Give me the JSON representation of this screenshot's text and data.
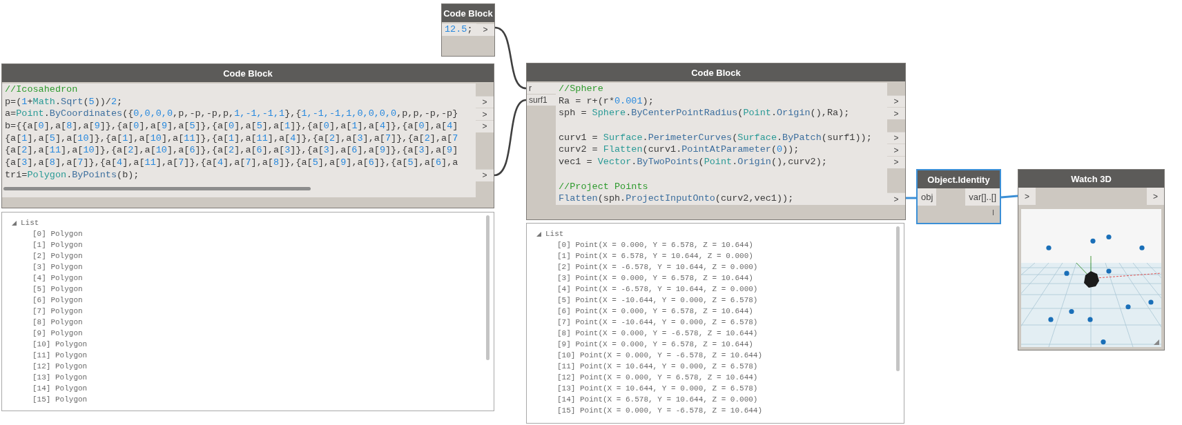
{
  "nodes": [
    {
      "kind": "code",
      "title": "Code Block",
      "selected": false,
      "lines": [
        {
          "kind": "code",
          "segs": [
            {
              "t": "12.5",
              "kind": "number"
            },
            {
              "t": ";"
            }
          ],
          "port": ">"
        }
      ]
    },
    {
      "kind": "code",
      "title": "Code Block",
      "selected": false,
      "lines": [
        {
          "kind": "code",
          "segs": [
            {
              "t": "//Icosahedron",
              "kind": "comment"
            }
          ]
        },
        {
          "kind": "code",
          "segs": [
            {
              "t": "p=("
            },
            {
              "t": "1",
              "kind": "number"
            },
            {
              "t": "+"
            },
            {
              "t": "Math",
              "kind": "type"
            },
            {
              "t": "."
            },
            {
              "t": "Sqrt",
              "kind": "method"
            },
            {
              "t": "("
            },
            {
              "t": "5",
              "kind": "number"
            },
            {
              "t": "))/"
            },
            {
              "t": "2",
              "kind": "number"
            },
            {
              "t": ";"
            }
          ],
          "port": ">"
        },
        {
          "kind": "code",
          "segs": [
            {
              "t": "a="
            },
            {
              "t": "Point",
              "kind": "type"
            },
            {
              "t": "."
            },
            {
              "t": "ByCoordinates",
              "kind": "method"
            },
            {
              "t": "({"
            },
            {
              "t": "0,0,0,0",
              "kind": "number"
            },
            {
              "t": ",p,-p,-p,p,"
            },
            {
              "t": "1,-1,-1,1",
              "kind": "number"
            },
            {
              "t": "},{"
            },
            {
              "t": "1,-1,-1,1,0,0,0,0",
              "kind": "number"
            },
            {
              "t": ",p,p,-p,-p}"
            }
          ],
          "port": ">"
        },
        {
          "kind": "code",
          "segs": [
            {
              "t": "b={{a["
            },
            {
              "t": "0",
              "kind": "number"
            },
            {
              "t": "],a["
            },
            {
              "t": "8",
              "kind": "number"
            },
            {
              "t": "],a["
            },
            {
              "t": "9",
              "kind": "number"
            },
            {
              "t": "]},{a["
            },
            {
              "t": "0",
              "kind": "number"
            },
            {
              "t": "],a["
            },
            {
              "t": "9",
              "kind": "number"
            },
            {
              "t": "],a["
            },
            {
              "t": "5",
              "kind": "number"
            },
            {
              "t": "]},{a["
            },
            {
              "t": "0",
              "kind": "number"
            },
            {
              "t": "],a["
            },
            {
              "t": "5",
              "kind": "number"
            },
            {
              "t": "],a["
            },
            {
              "t": "1",
              "kind": "number"
            },
            {
              "t": "]},{a["
            },
            {
              "t": "0",
              "kind": "number"
            },
            {
              "t": "],a["
            },
            {
              "t": "1",
              "kind": "number"
            },
            {
              "t": "],a["
            },
            {
              "t": "4",
              "kind": "number"
            },
            {
              "t": "]},{a["
            },
            {
              "t": "0",
              "kind": "number"
            },
            {
              "t": "],a["
            },
            {
              "t": "4",
              "kind": "number"
            },
            {
              "t": "]"
            }
          ],
          "port": ">"
        },
        {
          "kind": "code",
          "segs": [
            {
              "t": "{a["
            },
            {
              "t": "1",
              "kind": "number"
            },
            {
              "t": "],a["
            },
            {
              "t": "5",
              "kind": "number"
            },
            {
              "t": "],a["
            },
            {
              "t": "10",
              "kind": "number"
            },
            {
              "t": "]},{a["
            },
            {
              "t": "1",
              "kind": "number"
            },
            {
              "t": "],a["
            },
            {
              "t": "10",
              "kind": "number"
            },
            {
              "t": "],a["
            },
            {
              "t": "11",
              "kind": "number"
            },
            {
              "t": "]},{a["
            },
            {
              "t": "1",
              "kind": "number"
            },
            {
              "t": "],a["
            },
            {
              "t": "11",
              "kind": "number"
            },
            {
              "t": "],a["
            },
            {
              "t": "4",
              "kind": "number"
            },
            {
              "t": "]},{a["
            },
            {
              "t": "2",
              "kind": "number"
            },
            {
              "t": "],a["
            },
            {
              "t": "3",
              "kind": "number"
            },
            {
              "t": "],a["
            },
            {
              "t": "7",
              "kind": "number"
            },
            {
              "t": "]},{a["
            },
            {
              "t": "2",
              "kind": "number"
            },
            {
              "t": "],a["
            },
            {
              "t": "7",
              "kind": "number"
            }
          ]
        },
        {
          "kind": "code",
          "segs": [
            {
              "t": "{a["
            },
            {
              "t": "2",
              "kind": "number"
            },
            {
              "t": "],a["
            },
            {
              "t": "11",
              "kind": "number"
            },
            {
              "t": "],a["
            },
            {
              "t": "10",
              "kind": "number"
            },
            {
              "t": "]},{a["
            },
            {
              "t": "2",
              "kind": "number"
            },
            {
              "t": "],a["
            },
            {
              "t": "10",
              "kind": "number"
            },
            {
              "t": "],a["
            },
            {
              "t": "6",
              "kind": "number"
            },
            {
              "t": "]},{a["
            },
            {
              "t": "2",
              "kind": "number"
            },
            {
              "t": "],a["
            },
            {
              "t": "6",
              "kind": "number"
            },
            {
              "t": "],a["
            },
            {
              "t": "3",
              "kind": "number"
            },
            {
              "t": "]},{a["
            },
            {
              "t": "3",
              "kind": "number"
            },
            {
              "t": "],a["
            },
            {
              "t": "6",
              "kind": "number"
            },
            {
              "t": "],a["
            },
            {
              "t": "9",
              "kind": "number"
            },
            {
              "t": "]},{a["
            },
            {
              "t": "3",
              "kind": "number"
            },
            {
              "t": "],a["
            },
            {
              "t": "9",
              "kind": "number"
            },
            {
              "t": "]"
            }
          ]
        },
        {
          "kind": "code",
          "segs": [
            {
              "t": "{a["
            },
            {
              "t": "3",
              "kind": "number"
            },
            {
              "t": "],a["
            },
            {
              "t": "8",
              "kind": "number"
            },
            {
              "t": "],a["
            },
            {
              "t": "7",
              "kind": "number"
            },
            {
              "t": "]},{a["
            },
            {
              "t": "4",
              "kind": "number"
            },
            {
              "t": "],a["
            },
            {
              "t": "11",
              "kind": "number"
            },
            {
              "t": "],a["
            },
            {
              "t": "7",
              "kind": "number"
            },
            {
              "t": "]},{a["
            },
            {
              "t": "4",
              "kind": "number"
            },
            {
              "t": "],a["
            },
            {
              "t": "7",
              "kind": "number"
            },
            {
              "t": "],a["
            },
            {
              "t": "8",
              "kind": "number"
            },
            {
              "t": "]},{a["
            },
            {
              "t": "5",
              "kind": "number"
            },
            {
              "t": "],a["
            },
            {
              "t": "9",
              "kind": "number"
            },
            {
              "t": "],a["
            },
            {
              "t": "6",
              "kind": "number"
            },
            {
              "t": "]},{a["
            },
            {
              "t": "5",
              "kind": "number"
            },
            {
              "t": "],a["
            },
            {
              "t": "6",
              "kind": "number"
            },
            {
              "t": "],a"
            }
          ]
        },
        {
          "kind": "code",
          "segs": [
            {
              "t": "tri="
            },
            {
              "t": "Polygon",
              "kind": "type"
            },
            {
              "t": "."
            },
            {
              "t": "ByPoints",
              "kind": "method"
            },
            {
              "t": "(b);"
            }
          ],
          "port": ">"
        }
      ],
      "preview": {
        "root": "List",
        "expanded": true,
        "items": [
          "[0] Polygon",
          "[1] Polygon",
          "[2] Polygon",
          "[3] Polygon",
          "[4] Polygon",
          "[5] Polygon",
          "[6] Polygon",
          "[7] Polygon",
          "[8] Polygon",
          "[9] Polygon",
          "[10] Polygon",
          "[11] Polygon",
          "[12] Polygon",
          "[13] Polygon",
          "[14] Polygon",
          "[15] Polygon"
        ]
      }
    },
    {
      "kind": "code",
      "title": "Code Block",
      "selected": false,
      "inputs": [
        "r",
        "surf1"
      ],
      "lines": [
        {
          "kind": "code",
          "segs": [
            {
              "t": "//Sphere",
              "kind": "comment"
            }
          ]
        },
        {
          "kind": "code",
          "segs": [
            {
              "t": "Ra = r+(r*"
            },
            {
              "t": "0.001",
              "kind": "number"
            },
            {
              "t": ");"
            }
          ],
          "port": ">"
        },
        {
          "kind": "code",
          "segs": [
            {
              "t": "sph = "
            },
            {
              "t": "Sphere",
              "kind": "type"
            },
            {
              "t": "."
            },
            {
              "t": "ByCenterPointRadius",
              "kind": "method"
            },
            {
              "t": "("
            },
            {
              "t": "Point",
              "kind": "type"
            },
            {
              "t": "."
            },
            {
              "t": "Origin",
              "kind": "method"
            },
            {
              "t": "(),Ra);"
            }
          ],
          "port": ">"
        },
        {
          "kind": "blank"
        },
        {
          "kind": "code",
          "segs": [
            {
              "t": "curv1 = "
            },
            {
              "t": "Surface",
              "kind": "type"
            },
            {
              "t": "."
            },
            {
              "t": "PerimeterCurves",
              "kind": "method"
            },
            {
              "t": "("
            },
            {
              "t": "Surface",
              "kind": "type"
            },
            {
              "t": "."
            },
            {
              "t": "ByPatch",
              "kind": "method"
            },
            {
              "t": "(surf1));"
            }
          ],
          "port": ">"
        },
        {
          "kind": "code",
          "segs": [
            {
              "t": "curv2 = "
            },
            {
              "t": "Flatten",
              "kind": "type"
            },
            {
              "t": "(curv1."
            },
            {
              "t": "PointAtParameter",
              "kind": "method"
            },
            {
              "t": "("
            },
            {
              "t": "0",
              "kind": "number"
            },
            {
              "t": "));"
            }
          ],
          "port": ">"
        },
        {
          "kind": "code",
          "segs": [
            {
              "t": "vec1 = "
            },
            {
              "t": "Vector",
              "kind": "type"
            },
            {
              "t": "."
            },
            {
              "t": "ByTwoPoints",
              "kind": "method"
            },
            {
              "t": "("
            },
            {
              "t": "Point",
              "kind": "type"
            },
            {
              "t": "."
            },
            {
              "t": "Origin",
              "kind": "method"
            },
            {
              "t": "(),curv2);"
            }
          ],
          "port": ">"
        },
        {
          "kind": "blank"
        },
        {
          "kind": "code",
          "segs": [
            {
              "t": "//Project Points",
              "kind": "comment"
            }
          ]
        },
        {
          "kind": "code",
          "segs": [
            {
              "t": "Flatten",
              "kind": "method"
            },
            {
              "t": "(sph."
            },
            {
              "t": "ProjectInputOnto",
              "kind": "method"
            },
            {
              "t": "(curv2,vec1));"
            }
          ],
          "port": ">"
        }
      ],
      "preview": {
        "root": "List",
        "expanded": true,
        "items": [
          "[0] Point(X = 0.000, Y = 6.578, Z = 10.644)",
          "[1] Point(X = 6.578, Y = 10.644, Z = 0.000)",
          "[2] Point(X = -6.578, Y = 10.644, Z = 0.000)",
          "[3] Point(X = 0.000, Y = 6.578, Z = 10.644)",
          "[4] Point(X = -6.578, Y = 10.644, Z = 0.000)",
          "[5] Point(X = -10.644, Y = 0.000, Z = 6.578)",
          "[6] Point(X = 0.000, Y = 6.578, Z = 10.644)",
          "[7] Point(X = -10.644, Y = 0.000, Z = 6.578)",
          "[8] Point(X = 0.000, Y = -6.578, Z = 10.644)",
          "[9] Point(X = 0.000, Y = 6.578, Z = 10.644)",
          "[10] Point(X = 0.000, Y = -6.578, Z = 10.644)",
          "[11] Point(X = 10.644, Y = 0.000, Z = 6.578)",
          "[12] Point(X = 0.000, Y = 6.578, Z = 10.644)",
          "[13] Point(X = 10.644, Y = 0.000, Z = 6.578)",
          "[14] Point(X = 6.578, Y = 10.644, Z = 0.000)",
          "[15] Point(X = 0.000, Y = -6.578, Z = 10.644)"
        ]
      }
    },
    {
      "kind": "identity",
      "title": "Object.Identity",
      "selected": true,
      "inputs": [
        "obj"
      ],
      "outputs": [
        "var[]..[]"
      ],
      "lacing": "I"
    },
    {
      "kind": "watch3d",
      "title": "Watch 3D",
      "selected": false,
      "inputs": [
        ">"
      ],
      "outputs": [
        ">"
      ],
      "view": {
        "kind": "picture"
      }
    }
  ]
}
